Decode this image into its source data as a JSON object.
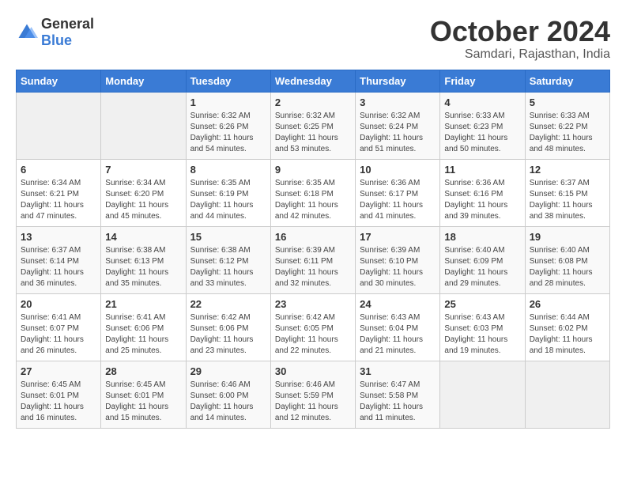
{
  "logo": {
    "general": "General",
    "blue": "Blue"
  },
  "title": "October 2024",
  "location": "Samdari, Rajasthan, India",
  "weekdays": [
    "Sunday",
    "Monday",
    "Tuesday",
    "Wednesday",
    "Thursday",
    "Friday",
    "Saturday"
  ],
  "weeks": [
    [
      {
        "day": "",
        "text": ""
      },
      {
        "day": "",
        "text": ""
      },
      {
        "day": "1",
        "text": "Sunrise: 6:32 AM\nSunset: 6:26 PM\nDaylight: 11 hours and 54 minutes."
      },
      {
        "day": "2",
        "text": "Sunrise: 6:32 AM\nSunset: 6:25 PM\nDaylight: 11 hours and 53 minutes."
      },
      {
        "day": "3",
        "text": "Sunrise: 6:32 AM\nSunset: 6:24 PM\nDaylight: 11 hours and 51 minutes."
      },
      {
        "day": "4",
        "text": "Sunrise: 6:33 AM\nSunset: 6:23 PM\nDaylight: 11 hours and 50 minutes."
      },
      {
        "day": "5",
        "text": "Sunrise: 6:33 AM\nSunset: 6:22 PM\nDaylight: 11 hours and 48 minutes."
      }
    ],
    [
      {
        "day": "6",
        "text": "Sunrise: 6:34 AM\nSunset: 6:21 PM\nDaylight: 11 hours and 47 minutes."
      },
      {
        "day": "7",
        "text": "Sunrise: 6:34 AM\nSunset: 6:20 PM\nDaylight: 11 hours and 45 minutes."
      },
      {
        "day": "8",
        "text": "Sunrise: 6:35 AM\nSunset: 6:19 PM\nDaylight: 11 hours and 44 minutes."
      },
      {
        "day": "9",
        "text": "Sunrise: 6:35 AM\nSunset: 6:18 PM\nDaylight: 11 hours and 42 minutes."
      },
      {
        "day": "10",
        "text": "Sunrise: 6:36 AM\nSunset: 6:17 PM\nDaylight: 11 hours and 41 minutes."
      },
      {
        "day": "11",
        "text": "Sunrise: 6:36 AM\nSunset: 6:16 PM\nDaylight: 11 hours and 39 minutes."
      },
      {
        "day": "12",
        "text": "Sunrise: 6:37 AM\nSunset: 6:15 PM\nDaylight: 11 hours and 38 minutes."
      }
    ],
    [
      {
        "day": "13",
        "text": "Sunrise: 6:37 AM\nSunset: 6:14 PM\nDaylight: 11 hours and 36 minutes."
      },
      {
        "day": "14",
        "text": "Sunrise: 6:38 AM\nSunset: 6:13 PM\nDaylight: 11 hours and 35 minutes."
      },
      {
        "day": "15",
        "text": "Sunrise: 6:38 AM\nSunset: 6:12 PM\nDaylight: 11 hours and 33 minutes."
      },
      {
        "day": "16",
        "text": "Sunrise: 6:39 AM\nSunset: 6:11 PM\nDaylight: 11 hours and 32 minutes."
      },
      {
        "day": "17",
        "text": "Sunrise: 6:39 AM\nSunset: 6:10 PM\nDaylight: 11 hours and 30 minutes."
      },
      {
        "day": "18",
        "text": "Sunrise: 6:40 AM\nSunset: 6:09 PM\nDaylight: 11 hours and 29 minutes."
      },
      {
        "day": "19",
        "text": "Sunrise: 6:40 AM\nSunset: 6:08 PM\nDaylight: 11 hours and 28 minutes."
      }
    ],
    [
      {
        "day": "20",
        "text": "Sunrise: 6:41 AM\nSunset: 6:07 PM\nDaylight: 11 hours and 26 minutes."
      },
      {
        "day": "21",
        "text": "Sunrise: 6:41 AM\nSunset: 6:06 PM\nDaylight: 11 hours and 25 minutes."
      },
      {
        "day": "22",
        "text": "Sunrise: 6:42 AM\nSunset: 6:06 PM\nDaylight: 11 hours and 23 minutes."
      },
      {
        "day": "23",
        "text": "Sunrise: 6:42 AM\nSunset: 6:05 PM\nDaylight: 11 hours and 22 minutes."
      },
      {
        "day": "24",
        "text": "Sunrise: 6:43 AM\nSunset: 6:04 PM\nDaylight: 11 hours and 21 minutes."
      },
      {
        "day": "25",
        "text": "Sunrise: 6:43 AM\nSunset: 6:03 PM\nDaylight: 11 hours and 19 minutes."
      },
      {
        "day": "26",
        "text": "Sunrise: 6:44 AM\nSunset: 6:02 PM\nDaylight: 11 hours and 18 minutes."
      }
    ],
    [
      {
        "day": "27",
        "text": "Sunrise: 6:45 AM\nSunset: 6:01 PM\nDaylight: 11 hours and 16 minutes."
      },
      {
        "day": "28",
        "text": "Sunrise: 6:45 AM\nSunset: 6:01 PM\nDaylight: 11 hours and 15 minutes."
      },
      {
        "day": "29",
        "text": "Sunrise: 6:46 AM\nSunset: 6:00 PM\nDaylight: 11 hours and 14 minutes."
      },
      {
        "day": "30",
        "text": "Sunrise: 6:46 AM\nSunset: 5:59 PM\nDaylight: 11 hours and 12 minutes."
      },
      {
        "day": "31",
        "text": "Sunrise: 6:47 AM\nSunset: 5:58 PM\nDaylight: 11 hours and 11 minutes."
      },
      {
        "day": "",
        "text": ""
      },
      {
        "day": "",
        "text": ""
      }
    ]
  ]
}
